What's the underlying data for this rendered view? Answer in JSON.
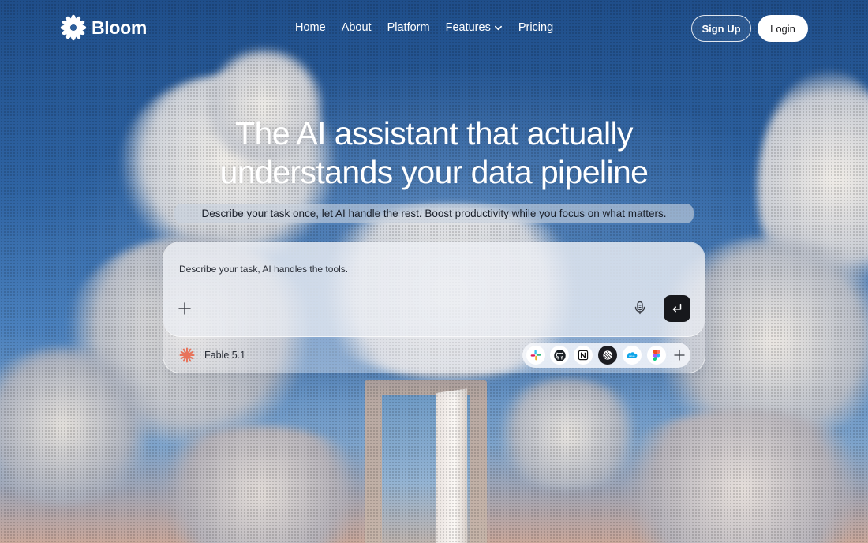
{
  "nav": {
    "brand": "Bloom",
    "items": [
      {
        "label": "Home"
      },
      {
        "label": "About"
      },
      {
        "label": "Platform"
      },
      {
        "label": "Features"
      },
      {
        "label": "Pricing"
      }
    ],
    "signup_label": "Sign Up",
    "login_label": "Login"
  },
  "hero": {
    "headline_line1": "The AI assistant that actually",
    "headline_line2": "understands your data pipeline",
    "subheadline": "Describe your task once, let AI handle the rest. Boost productivity while you focus on what matters."
  },
  "prompt": {
    "placeholder": "Describe your task,  AI handles the tools.",
    "model_name": "Fable 5.1",
    "tools": [
      "slack-icon",
      "github-icon",
      "notion-icon",
      "linear-icon",
      "salesforce-icon",
      "figma-icon"
    ]
  },
  "colors": {
    "sky_top": "#1f4e8a",
    "sky_mid": "#4a80bd",
    "send_button": "#17181c",
    "model_accent": "#e8735a"
  }
}
